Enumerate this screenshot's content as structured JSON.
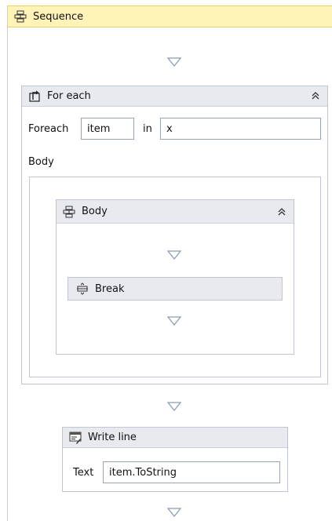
{
  "sequence": {
    "title": "Sequence",
    "icon": "sequence-icon"
  },
  "foreach": {
    "title": "For each",
    "icon": "foreach-icon",
    "foreach_label": "Foreach",
    "item_value": "item",
    "in_label": "in",
    "collection_value": "x",
    "body_label": "Body"
  },
  "body": {
    "title": "Body",
    "icon": "sequence-icon"
  },
  "break": {
    "title": "Break",
    "icon": "break-icon"
  },
  "writeline": {
    "title": "Write line",
    "icon": "writeline-icon",
    "text_label": "Text",
    "text_value": "item.ToString"
  },
  "colors": {
    "sequence_header": "#fff3b8",
    "sequence_border": "#f0d060",
    "card_header": "#e8eaf0",
    "card_border": "#bfc6d1",
    "arrow": "#8a9ab0"
  }
}
